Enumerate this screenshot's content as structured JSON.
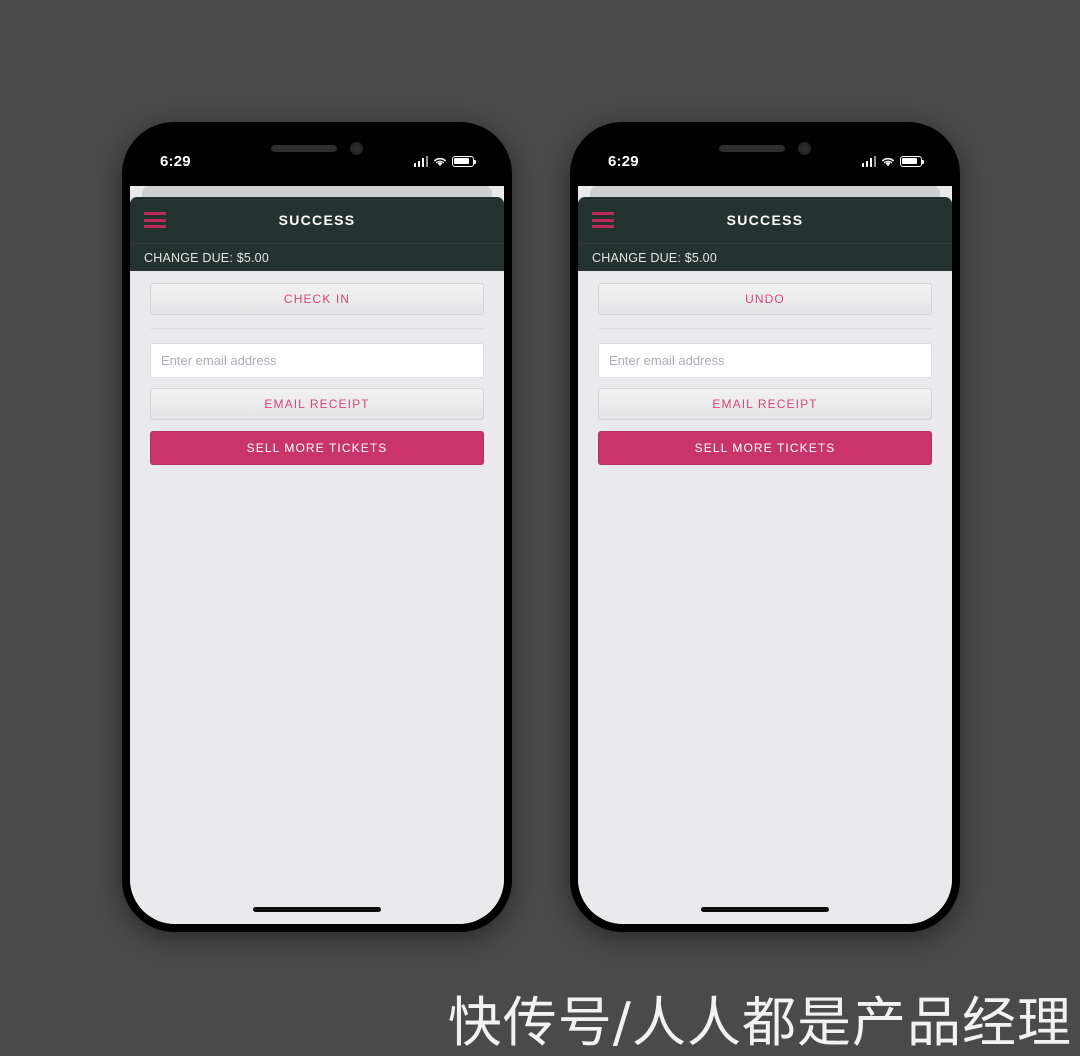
{
  "background_color": "#4a4a4a",
  "theme": {
    "appbar_bg": "#243230",
    "content_bg": "#eaeaec",
    "accent_pink": "#c9356a",
    "secondary_text_pink": "#d04a72",
    "hamburger_color": "#c02a5a"
  },
  "phones": [
    {
      "id": "left",
      "status_bar": {
        "time": "6:29",
        "signal_icon": "cellular-signal-icon",
        "wifi_icon": "wifi-icon",
        "battery_icon": "battery-icon"
      },
      "appbar": {
        "menu_icon": "hamburger-menu-icon",
        "title": "SUCCESS"
      },
      "subbar": {
        "change_due": "CHANGE DUE: $5.00"
      },
      "content": {
        "action_button": "CHECK IN",
        "email_placeholder": "Enter email address",
        "email_value": "",
        "email_receipt_button": "EMAIL RECEIPT",
        "primary_button": "SELL MORE TICKETS"
      }
    },
    {
      "id": "right",
      "status_bar": {
        "time": "6:29",
        "signal_icon": "cellular-signal-icon",
        "wifi_icon": "wifi-icon",
        "battery_icon": "battery-icon"
      },
      "appbar": {
        "menu_icon": "hamburger-menu-icon",
        "title": "SUCCESS"
      },
      "subbar": {
        "change_due": "CHANGE DUE: $5.00"
      },
      "content": {
        "action_button": "UNDO",
        "email_placeholder": "Enter email address",
        "email_value": "",
        "email_receipt_button": "EMAIL RECEIPT",
        "primary_button": "SELL MORE TICKETS"
      }
    }
  ],
  "watermark": {
    "text": "快传号/人人都是产品经理"
  }
}
